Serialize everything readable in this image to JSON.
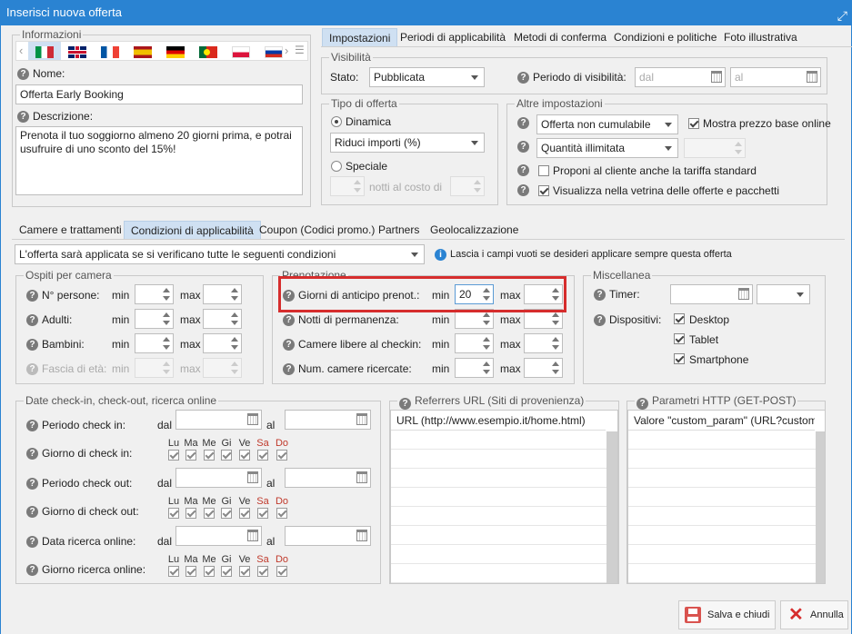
{
  "window": {
    "title": "Inserisci nuova offerta"
  },
  "info": {
    "legend": "Informazioni",
    "nome_label": "Nome:",
    "nome_value": "Offerta Early Booking",
    "desc_label": "Descrizione:",
    "desc_value": "Prenota il tuo soggiorno almeno 20 giorni prima, e potrai usufruire di uno sconto del 15%!",
    "flags": [
      "italian-flag",
      "english-flag",
      "french-flag",
      "spanish-flag",
      "german-flag",
      "portuguese-flag",
      "polish-flag",
      "russian-flag"
    ]
  },
  "top_tabs": [
    "Impostazioni",
    "Periodi di applicabilità",
    "Metodi di conferma",
    "Condizioni e politiche",
    "Foto illustrativa"
  ],
  "visibilita": {
    "legend": "Visibilità",
    "stato_label": "Stato:",
    "stato_value": "Pubblicata",
    "periodo_label": "Periodo di visibilità:",
    "dal_ph": "dal",
    "al_ph": "al"
  },
  "tipo": {
    "legend": "Tipo di offerta",
    "dinamica": "Dinamica",
    "riduci": "Riduci importi (%)",
    "speciale": "Speciale",
    "notti": "notti al costo di"
  },
  "altre": {
    "legend": "Altre impostazioni",
    "cumulabile": "Offerta non cumulabile",
    "mostra": "Mostra prezzo base online",
    "quantita": "Quantità illimitata",
    "proponi": "Proponi al cliente anche la tariffa standard",
    "visualizza": "Visualizza nella vetrina delle offerte e pacchetti"
  },
  "sub_tabs": [
    "Camere e trattamenti",
    "Condizioni di applicabilità",
    "Coupon (Codici promo.)",
    "Partners",
    "Geolocalizzazione"
  ],
  "condizioni": {
    "select": "L'offerta sarà applicata se si verificano tutte le seguenti condizioni",
    "info": "Lascia i campi vuoti se desideri applicare sempre questa offerta"
  },
  "ospiti": {
    "legend": "Ospiti per camera",
    "rows": [
      "N° persone:",
      "Adulti:",
      "Bambini:",
      "Fascia di età:"
    ],
    "min": "min",
    "max": "max"
  },
  "prenotazione": {
    "legend": "Prenotazione",
    "rows": [
      "Giorni di anticipo prenot.:",
      "Notti di permanenza:",
      "Camere libere al checkin:",
      "Num. camere ricercate:"
    ],
    "min": "min",
    "max": "max",
    "anticipo_min": "20"
  },
  "misc": {
    "legend": "Miscellanea",
    "timer": "Timer:",
    "dispositivi": "Dispositivi:",
    "devices": [
      "Desktop",
      "Tablet",
      "Smartphone"
    ]
  },
  "date": {
    "legend": "Date check-in, check-out, ricerca online",
    "periodo_in": "Periodo check in:",
    "giorno_in": "Giorno di check in:",
    "periodo_out": "Periodo check out:",
    "giorno_out": "Giorno di check out:",
    "data_ricerca": "Data ricerca online:",
    "giorno_ricerca": "Giorno ricerca online:",
    "dal": "dal",
    "al": "al",
    "days": [
      "Lu",
      "Ma",
      "Me",
      "Gi",
      "Ve",
      "Sa",
      "Do"
    ]
  },
  "referrers": {
    "legend": "Referrers URL (Siti di provenienza)",
    "header": "URL (http://www.esempio.it/home.html)"
  },
  "params": {
    "legend": "Parametri HTTP (GET-POST)",
    "header": "Valore \"custom_param\" (URL?custom_param=..."
  },
  "buttons": {
    "save": "Salva e chiudi",
    "cancel": "Annulla"
  },
  "colors": {
    "accent": "#2a83d2",
    "highlight": "#d62d2d"
  }
}
